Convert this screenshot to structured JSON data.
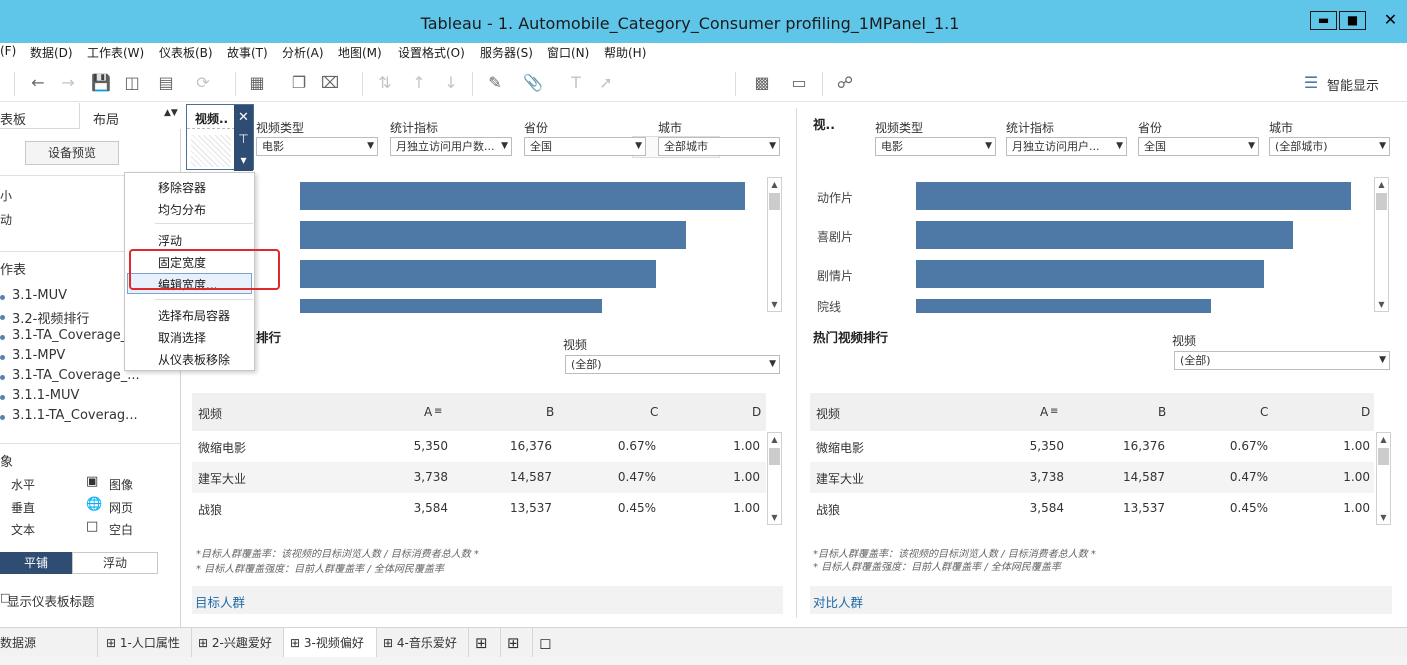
{
  "window": {
    "title": "Tableau - 1. Automobile_Category_Consumer profiling_1MPanel_1.1",
    "min_label": "▬",
    "max_label": "■",
    "close_label": "✕"
  },
  "menu": [
    "(F)",
    "数据(D)",
    "工作表(W)",
    "仪表板(B)",
    "故事(T)",
    "分析(A)",
    "地图(M)",
    "设置格式(O)",
    "服务器(S)",
    "窗口(N)",
    "帮助(H)"
  ],
  "toolbar": {
    "show_me_label": "智能显示"
  },
  "left_panel": {
    "tab_dashboard": "表板",
    "tab_layout": "布局",
    "device_preview": "设备预览",
    "size_label": "小",
    "size_value": "动",
    "sheets_header": "作表",
    "sheets": [
      "3.1-MUV",
      "3.2-视频排行",
      "3.1-TA_Coverage_...",
      "3.1-MPV",
      "3.1-TA_Coverage_...",
      "3.1.1-MUV",
      "3.1.1-TA_Coverag..."
    ],
    "objects_header": "象",
    "objects": [
      {
        "label": "水平",
        "icon": ""
      },
      {
        "label": "图像",
        "icon": "image-icon"
      },
      {
        "label": "垂直",
        "icon": ""
      },
      {
        "label": "网页",
        "icon": "globe-icon"
      },
      {
        "label": "文本",
        "icon": ""
      },
      {
        "label": "空白",
        "icon": "blank-icon"
      }
    ],
    "tiled_label": "平铺",
    "floating_label": "浮动",
    "show_title_label": "显示仪表板标题"
  },
  "selector": {
    "label": "视频..",
    "close": "✕",
    "pin": "⊤",
    "more": "▾"
  },
  "context_menu": {
    "items_group1": [
      "移除容器",
      "均匀分布"
    ],
    "items_group2": [
      "浮动",
      "固定宽度",
      "编辑宽度..."
    ],
    "items_group3": [
      "选择布局容器",
      "取消选择",
      "从仪表板移除"
    ],
    "highlighted": "编辑宽度..."
  },
  "left_dash": {
    "filters": [
      {
        "label": "视频类型",
        "value": "电影"
      },
      {
        "label": "统计指标",
        "value": "月独立访问用户数..."
      },
      {
        "label": "省份",
        "value": "全国"
      },
      {
        "label": "城市",
        "value": "全部城市"
      }
    ],
    "bar_chart": {
      "categories": [
        "",
        "",
        "",
        ""
      ],
      "values": [
        445,
        386,
        356,
        302
      ]
    },
    "section_title": "排行",
    "video_filter": {
      "label": "视频",
      "value": "(全部)"
    },
    "table": {
      "headers": [
        "视频",
        "A",
        "B",
        "C",
        "D"
      ],
      "rows": [
        [
          "微缩电影",
          "5,350",
          "16,376",
          "0.67%",
          "1.00"
        ],
        [
          "建军大业",
          "3,738",
          "14,587",
          "0.47%",
          "1.00"
        ],
        [
          "战狼",
          "3,584",
          "13,537",
          "0.45%",
          "1.00"
        ]
      ]
    },
    "notes": [
      "*目标人群覆盖率：该视频的目标浏览人数 / 目标消费者总人数 *",
      "* 目标人群覆盖强度：目前人群覆盖率 / 全体网民覆盖率"
    ],
    "footer": "目标人群"
  },
  "right_dash": {
    "short_title": "视..",
    "filters": [
      {
        "label": "视频类型",
        "value": "电影"
      },
      {
        "label": "统计指标",
        "value": "月独立访问用户..."
      },
      {
        "label": "省份",
        "value": "全国"
      },
      {
        "label": "城市",
        "value": "(全部城市)"
      }
    ],
    "bar_chart": {
      "categories": [
        "动作片",
        "喜剧片",
        "剧情片",
        "院线"
      ],
      "values": [
        435,
        377,
        348,
        295
      ]
    },
    "section_title": "热门视频排行",
    "video_filter": {
      "label": "视频",
      "value": "(全部)"
    },
    "table": {
      "headers": [
        "视频",
        "A",
        "B",
        "C",
        "D"
      ],
      "rows": [
        [
          "微缩电影",
          "5,350",
          "16,376",
          "0.67%",
          "1.00"
        ],
        [
          "建军大业",
          "3,738",
          "14,587",
          "0.47%",
          "1.00"
        ],
        [
          "战狼",
          "3,584",
          "13,537",
          "0.45%",
          "1.00"
        ]
      ]
    },
    "notes": [
      "*目标人群覆盖率：该视频的目标浏览人数 / 目标消费者总人数 *",
      "* 目标人群覆盖强度：目前人群覆盖率 / 全体网民覆盖率"
    ],
    "footer": "对比人群"
  },
  "bottom_tabs": {
    "datasource": "数据源",
    "tabs": [
      "1-人口属性",
      "2-兴趣爱好",
      "3-视频偏好",
      "4-音乐爱好"
    ],
    "active": "3-视频偏好"
  },
  "colors": {
    "titlebar": "#5fc6ea",
    "bar": "#4e79a7",
    "selector": "#2f4d72",
    "highlight_box": "#e02a2a",
    "link": "#1f6aa8"
  }
}
